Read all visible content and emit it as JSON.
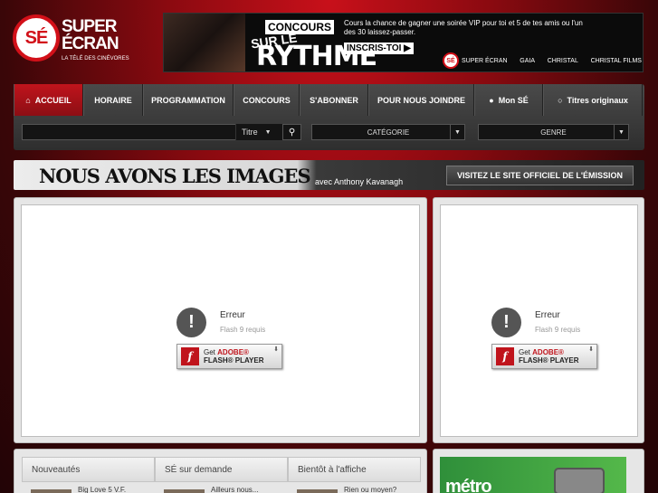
{
  "logo": {
    "mark": "SÉ",
    "line1": "SUPER",
    "line2": "ÉCRAN",
    "tagline": "LA TÉLÉ DES CINÉVORES"
  },
  "banner": {
    "concours": "CONCOURS",
    "sur": "SUR LE",
    "rythme": "RYTHME",
    "copy": "Cours la chance de gagner une soirée VIP pour toi et 5 de tes amis ou l'un des 30 laissez-passer.",
    "cta": "INSCRIS-TOI ▶",
    "partners": [
      "SUPER ÉCRAN",
      "GAIA",
      "CHRISTAL",
      "CHRISTAL FILMS"
    ]
  },
  "nav": {
    "tabs": [
      {
        "label": "ACCUEIL",
        "icon": "home-icon"
      },
      {
        "label": "HORAIRE"
      },
      {
        "label": "PROGRAMMATION"
      },
      {
        "label": "CONCOURS"
      },
      {
        "label": "S'ABONNER"
      },
      {
        "label": "POUR NOUS JOINDRE"
      },
      {
        "label": "Mon SÉ",
        "icon": "user-icon"
      },
      {
        "label": "Titres originaux",
        "icon": "radio-icon"
      }
    ],
    "search": {
      "value": "",
      "select": "Titre"
    },
    "category": "CATÉGORIE",
    "genre": "GENRE"
  },
  "promo": {
    "title": "NOUS AVONS LES IMAGES",
    "host": "avec Anthony Kavanagh",
    "button": "VISITEZ LE SITE OFFICIEL DE L'ÉMISSION"
  },
  "flash": {
    "title": "Erreur",
    "subtitle": "Flash 9 requis",
    "get": "Get",
    "adobe": "ADOBE®",
    "player": "FLASH® PLAYER"
  },
  "bottom": {
    "tabs": [
      "Nouveautés",
      "SÉ sur demande",
      "Bientôt à l'affiche"
    ],
    "items": [
      "Big Love 5 V.F.",
      "Ailleurs nous...",
      "Rien ou moyen?"
    ]
  },
  "ad": {
    "brand": "métro"
  }
}
